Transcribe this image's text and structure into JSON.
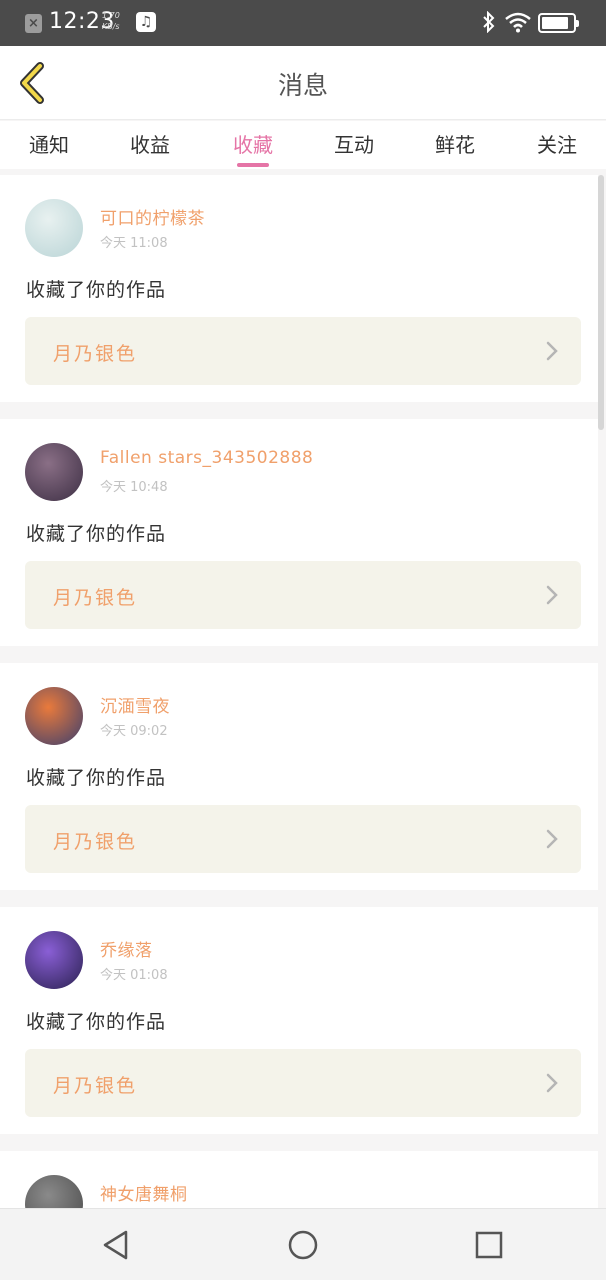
{
  "status_bar": {
    "time": "12:23",
    "net_speed_value": "1.70",
    "net_speed_unit": "KB/s",
    "battery_level": 0.85
  },
  "header": {
    "title": "消息"
  },
  "tabs": [
    {
      "label": "通知",
      "active": false
    },
    {
      "label": "收益",
      "active": false
    },
    {
      "label": "收藏",
      "active": true
    },
    {
      "label": "互动",
      "active": false
    },
    {
      "label": "鲜花",
      "active": false
    },
    {
      "label": "关注",
      "active": false
    }
  ],
  "items": [
    {
      "username": "可口的柠檬茶",
      "time": "今天 11:08",
      "action": "收藏了你的作品",
      "work_title": "月乃银色",
      "avatar_colors": [
        "#e8f1f0",
        "#b9d4d6"
      ]
    },
    {
      "username": "Fallen stars_343502888",
      "time": "今天 10:48",
      "action": "收藏了你的作品",
      "work_title": "月乃银色",
      "avatar_colors": [
        "#8a6f86",
        "#3d2f44"
      ]
    },
    {
      "username": "沉湎雪夜",
      "time": "今天 09:02",
      "action": "收藏了你的作品",
      "work_title": "月乃银色",
      "avatar_colors": [
        "#e97a3c",
        "#3c3f6e"
      ]
    },
    {
      "username": "乔缘落",
      "time": "今天 01:08",
      "action": "收藏了你的作品",
      "work_title": "月乃银色",
      "avatar_colors": [
        "#8a5fd6",
        "#2a2150"
      ]
    },
    {
      "username": "神女唐舞桐",
      "time": "",
      "action": "",
      "work_title": "",
      "avatar_colors": [
        "#8a8a8a",
        "#4a4a4a"
      ]
    }
  ],
  "colors": {
    "accent": "#e574a6",
    "name_orange": "#f0a06b",
    "card_bg": "#f4f3ea"
  },
  "icons": {
    "back": "chevron-left-icon",
    "chevron": "chevron-right-icon",
    "nav_back": "triangle-back-icon",
    "nav_home": "circle-home-icon",
    "nav_recent": "square-recent-icon"
  }
}
